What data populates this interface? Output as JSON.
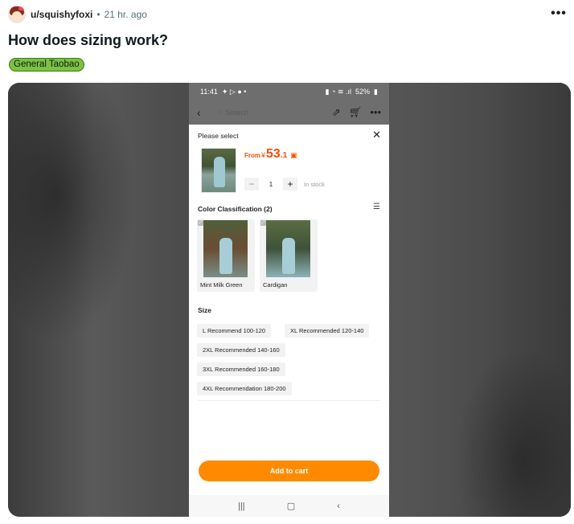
{
  "post": {
    "username": "u/squishyfoxi",
    "separator": "•",
    "time": "21 hr. ago",
    "title": "How does sizing work?",
    "flair": "General Taobao",
    "more_icon": "•••"
  },
  "phone": {
    "status": {
      "time": "11:41",
      "battery": "52%"
    },
    "nav": {
      "search_placeholder": "Search"
    },
    "sheet": {
      "title": "Please select",
      "price": {
        "from": "From",
        "currency": "¥",
        "integer": "53",
        "decimal": ".1"
      },
      "quantity": "1",
      "stock": "In stock",
      "color_label": "Color Classification (2)",
      "colors": [
        {
          "name": "Mint Milk Green"
        },
        {
          "name": "Cardigan"
        }
      ],
      "size_label": "Size",
      "sizes": [
        "L Recommend 100-120",
        "XL Recommended 120-140",
        "2XL Recommended 140-160",
        "3XL Recommended 160-180",
        "4XL Recommendation 180-200"
      ],
      "add_to_cart": "Add to cart"
    }
  },
  "icons": {
    "more": "more-icon",
    "back": "back-arrow-icon",
    "search": "search-icon",
    "share": "share-icon",
    "cart": "cart-icon",
    "close": "close-icon",
    "list_view": "list-view-icon"
  },
  "colors": {
    "accent_orange": "#ff8a00",
    "price_red": "#ff4a00",
    "flair_green": "#7dc142"
  }
}
